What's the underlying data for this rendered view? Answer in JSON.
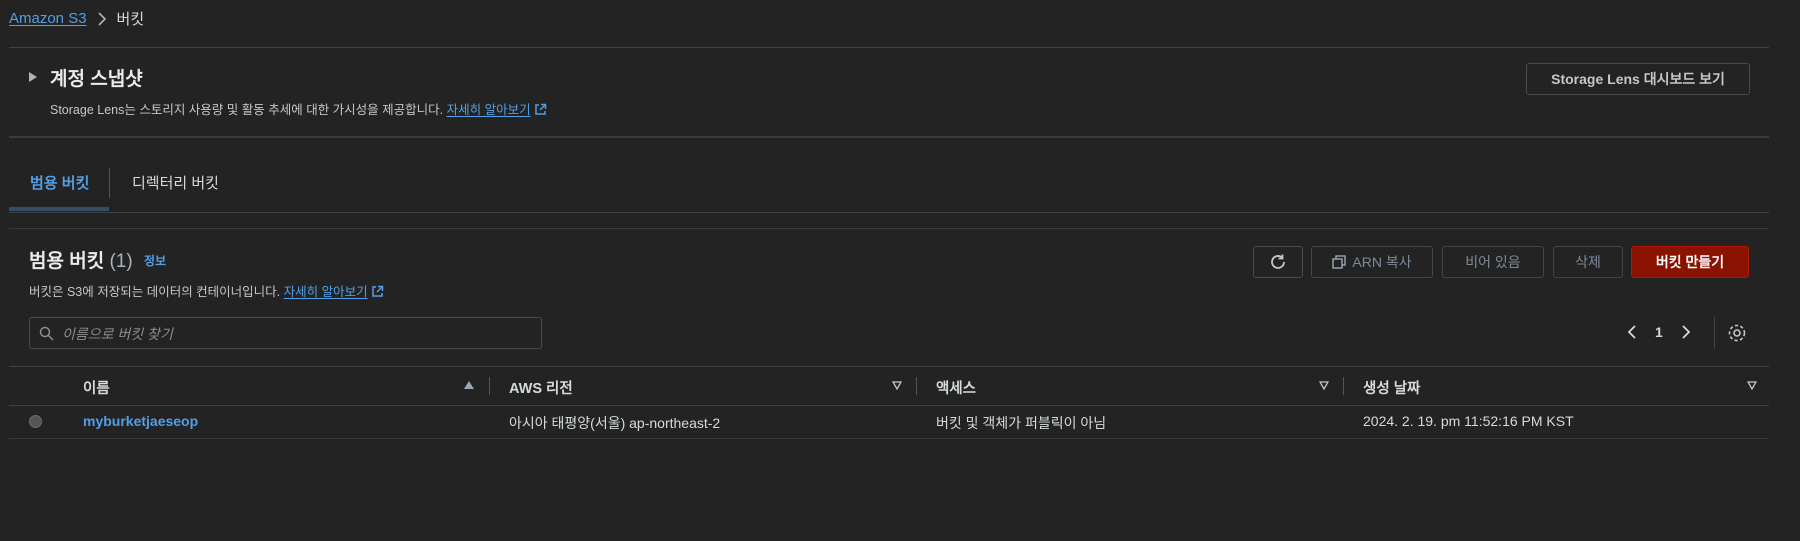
{
  "breadcrumb": {
    "root": "Amazon S3",
    "current": "버킷"
  },
  "snapshot": {
    "title": "계정 스냅샷",
    "desc_prefix": "Storage Lens는 스토리지 사용량 및 활동 추세에 대한 가시성을 제공합니다.",
    "learn_more": "자세히 알아보기",
    "dashboard_button": "Storage Lens 대시보드 보기"
  },
  "tabs": [
    {
      "label": "범용 버킷"
    },
    {
      "label": "디렉터리 버킷"
    }
  ],
  "buckets_panel": {
    "title": "범용 버킷",
    "count": "(1)",
    "info": "정보",
    "desc": "버킷은 S3에 저장되는 데이터의 컨테이너입니다.",
    "learn_more": "자세히 알아보기",
    "buttons": {
      "copy_arn": "ARN 복사",
      "empty": "비어 있음",
      "delete": "삭제",
      "create": "버킷 만들기"
    },
    "search_placeholder": "이름으로 버킷 찾기",
    "page": "1"
  },
  "table": {
    "columns": [
      "이름",
      "AWS 리전",
      "액세스",
      "생성 날짜"
    ],
    "rows": [
      {
        "name": "myburketjaeseop",
        "region": "아시아 태평양(서울) ap-northeast-2",
        "access": "버킷 및 객체가 퍼블릭이 아님",
        "created": "2024. 2. 19. pm 11:52:16 PM KST"
      }
    ]
  },
  "colors": {
    "accent": "#539fe5",
    "primary_button": "#8a1200",
    "background": "#232323"
  }
}
